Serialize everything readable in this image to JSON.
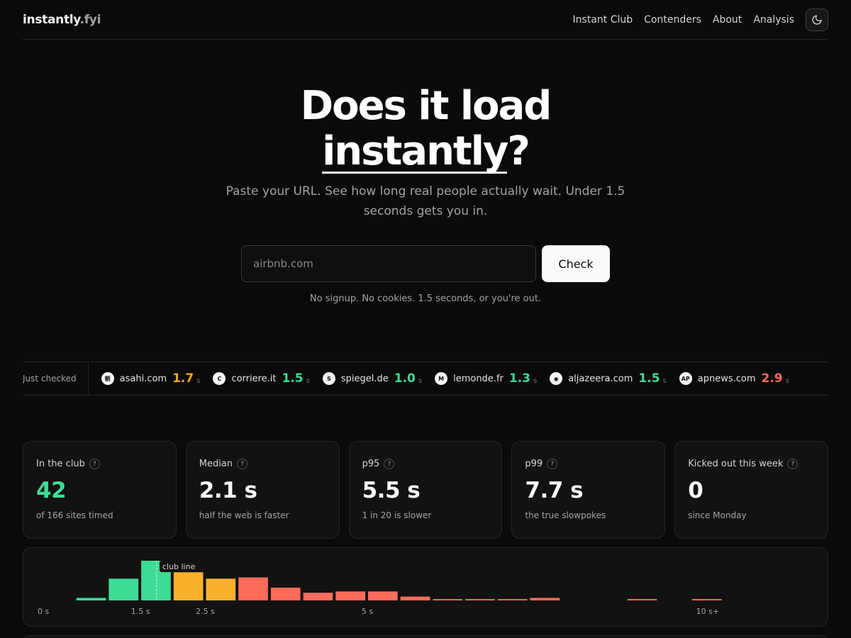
{
  "header": {
    "logo_main": "instantly",
    "logo_tld": ".fyi",
    "nav": [
      "Instant Club",
      "Contenders",
      "About",
      "Analysis"
    ]
  },
  "hero": {
    "title_line1": "Does it load",
    "title_word": "instantly",
    "title_mark": "?",
    "subtitle": "Paste your URL. See how long real people actually wait. Under 1.5 seconds gets you in.",
    "input_placeholder": "airbnb.com",
    "button_label": "Check",
    "note": "No signup. No cookies. 1.5 seconds, or you're out."
  },
  "ticker": {
    "label": "Just checked",
    "items": [
      {
        "domain": "asahi.com",
        "value": "1.7",
        "unit": "s",
        "color": "#f5a623",
        "icon": "asahi-favicon-icon",
        "glyph": "朝"
      },
      {
        "domain": "corriere.it",
        "value": "1.5",
        "unit": "s",
        "color": "#3ddc97",
        "icon": "corriere-favicon-icon",
        "glyph": "C"
      },
      {
        "domain": "spiegel.de",
        "value": "1.0",
        "unit": "s",
        "color": "#3ddc97",
        "icon": "spiegel-favicon-icon",
        "glyph": "S"
      },
      {
        "domain": "lemonde.fr",
        "value": "1.3",
        "unit": "s",
        "color": "#3ddc97",
        "icon": "lemonde-favicon-icon",
        "glyph": "M"
      },
      {
        "domain": "aljazeera.com",
        "value": "1.5",
        "unit": "s",
        "color": "#3ddc97",
        "icon": "aljazeera-favicon-icon",
        "glyph": "◉"
      },
      {
        "domain": "apnews.com",
        "value": "2.9",
        "unit": "s",
        "color": "#ff6b5b",
        "icon": "apnews-favicon-icon",
        "glyph": "AP"
      }
    ]
  },
  "stats": [
    {
      "label": "In the club",
      "value": "42",
      "desc": "of 166 sites timed",
      "color": "#3ddc97"
    },
    {
      "label": "Median",
      "value": "2.1 s",
      "desc": "half the web is faster",
      "color": "#fafafa"
    },
    {
      "label": "p95",
      "value": "5.5 s",
      "desc": "1 in 20 is slower",
      "color": "#fafafa"
    },
    {
      "label": "p99",
      "value": "7.7 s",
      "desc": "the true slowpokes",
      "color": "#fafafa"
    },
    {
      "label": "Kicked out this week",
      "value": "0",
      "desc": "since Monday",
      "color": "#fafafa"
    }
  ],
  "stats_help_glyph": "?",
  "chart_data": {
    "type": "bar",
    "x_bins_start_s": [
      0.5,
      1.0,
      1.5,
      2.0,
      2.5,
      3.0,
      3.5,
      4.0,
      4.5,
      5.0,
      5.5,
      6.0,
      6.5,
      7.0,
      7.5,
      8.0,
      8.5,
      9.0,
      9.5,
      10.0
    ],
    "bin_width_s": 0.5,
    "values": [
      2,
      17,
      31,
      22,
      17,
      18,
      10,
      6,
      7,
      7,
      3,
      1,
      1,
      1,
      2,
      0,
      0,
      1,
      0,
      1
    ],
    "bar_colors": [
      "#3ddc97",
      "#3ddc97",
      "#3ddc97",
      "#fbb12e",
      "#fbb12e",
      "#ff6b5b",
      "#ff6b5b",
      "#ff6b5b",
      "#ff6b5b",
      "#ff6b5b",
      "#ff6b5b",
      "#ff6b5b",
      "#ff6b5b",
      "#ff6b5b",
      "#ff6b5b",
      "#ff6b5b",
      "#ff6b5b",
      "#ff6b5b",
      "#ff6b5b",
      "#ff6b5b"
    ],
    "xlim": [
      0,
      10.5
    ],
    "x_tick_values": [
      0,
      1.5,
      2.5,
      5,
      10.25
    ],
    "x_tick_labels": [
      "0 s",
      "1.5 s",
      "2.5 s",
      "5 s",
      "10 s+"
    ],
    "club_line_x": 1.75,
    "club_line_label": "club line"
  }
}
